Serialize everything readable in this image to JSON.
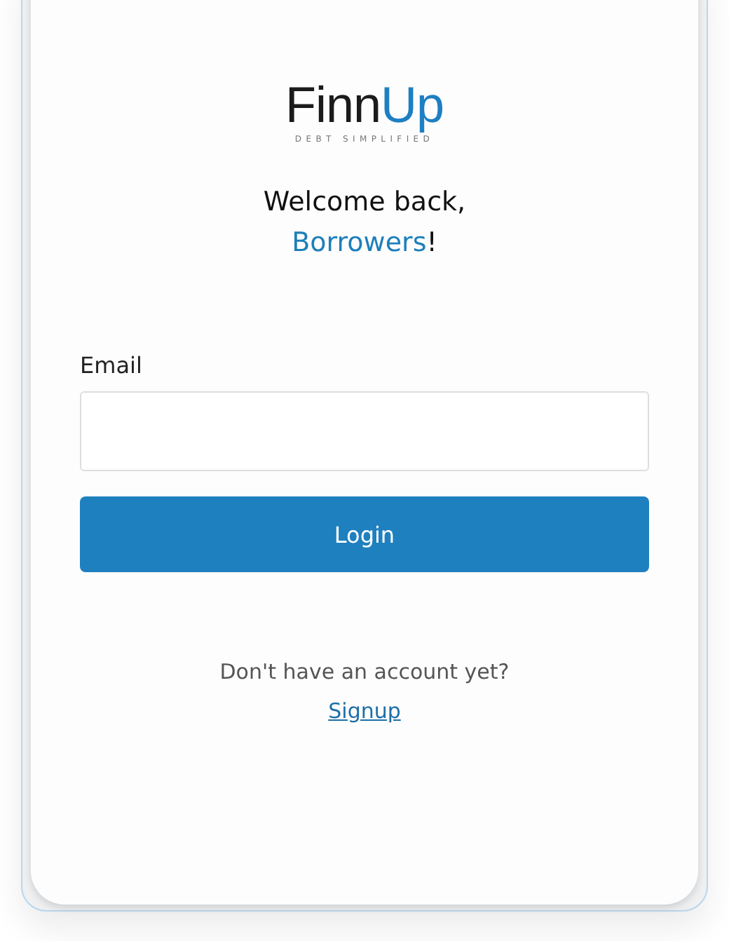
{
  "logo": {
    "dark_part": "Finn",
    "accent_part": "Up",
    "tagline": "DEBT SIMPLIFIED"
  },
  "heading": {
    "line_1": "Welcome back,",
    "name": "Borrowers",
    "suffix": "!"
  },
  "email": {
    "label": "Email"
  },
  "login_button": "Login",
  "signup_prompt": "Don't have an account yet?",
  "signup_link": "Signup"
}
